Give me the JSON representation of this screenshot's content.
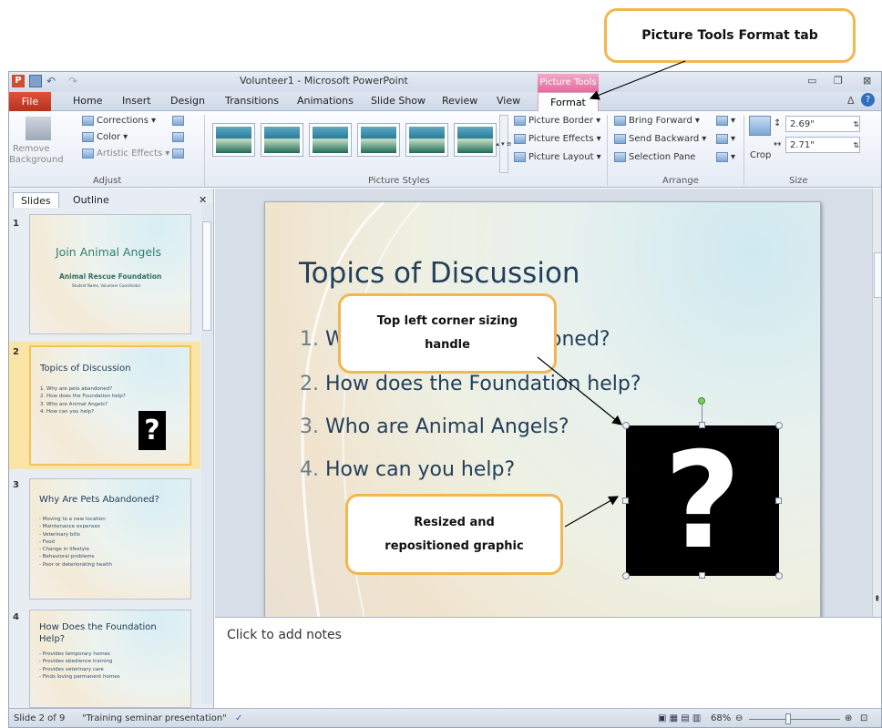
{
  "callouts": {
    "format_tab": "Picture Tools Format tab",
    "sizing_handle_line1": "Top left corner sizing",
    "sizing_handle_line2": "handle",
    "resized_line1": "Resized and",
    "resized_line2": "repositioned graphic"
  },
  "window": {
    "title": "Volunteer1 - Microsoft PowerPoint",
    "contextual_header": "Picture Tools"
  },
  "tabs": [
    "File",
    "Home",
    "Insert",
    "Design",
    "Transitions",
    "Animations",
    "Slide Show",
    "Review",
    "View",
    "Format"
  ],
  "ribbon": {
    "adjust": {
      "remove_bg_line1": "Remove",
      "remove_bg_line2": "Background",
      "corrections": "Corrections",
      "color": "Color",
      "artistic_effects": "Artistic Effects",
      "group_label": "Adjust"
    },
    "styles_group_label": "Picture Styles",
    "picture_border": "Picture Border",
    "picture_effects": "Picture Effects",
    "picture_layout": "Picture Layout",
    "arrange": {
      "bring_forward": "Bring Forward",
      "send_backward": "Send Backward",
      "selection_pane": "Selection Pane",
      "group_label": "Arrange"
    },
    "size": {
      "crop": "Crop",
      "height": "2.69\"",
      "width": "2.71\"",
      "group_label": "Size"
    }
  },
  "panel": {
    "tab_slides": "Slides",
    "tab_outline": "Outline"
  },
  "thumbnails": {
    "s1": {
      "num": "1",
      "title": "Join Animal Angels",
      "subtitle": "Animal Rescue Foundation",
      "byline": "Student Name, Volunteer Coordinator"
    },
    "s2": {
      "num": "2",
      "title": "Topics of Discussion",
      "lines": [
        "1.  Why are pets abandoned?",
        "2.  How does the Foundation   help?",
        "3.  Who are Animal Angels?",
        "4.  How can you help?"
      ]
    },
    "s3": {
      "num": "3",
      "title": "Why Are Pets Abandoned?",
      "lines": [
        "- Moving to a new location",
        "- Maintenance  expenses",
        "   - Veterinary bills",
        "   - Food",
        "- Change  in lifestyle",
        "- Behavioral  problems",
        "- Poor  or deteriorating  health"
      ]
    },
    "s4": {
      "num": "4",
      "title": "How Does the Foundation Help?",
      "lines": [
        "- Provides  temporary  homes",
        "- Provides  obedience  training",
        "- Provides  veterinary  care",
        "- Finds loving  permanent  homes"
      ]
    }
  },
  "slide": {
    "title": "Topics of Discussion",
    "items": [
      {
        "num": "1.",
        "text": "W"
      },
      {
        "num": "2.",
        "text": "How does the Foundation help?"
      },
      {
        "num": "3.",
        "text": "Who are Animal Angels?"
      },
      {
        "num": "4.",
        "text": "How can you help?"
      }
    ],
    "item1_tail": "oned?",
    "graphic_glyph": "?"
  },
  "notes_placeholder": "Click to add notes",
  "status": {
    "slide_pos": "Slide 2 of 9",
    "theme": "\"Training seminar presentation\"",
    "zoom": "68%"
  },
  "icons": [
    "powerpoint-icon",
    "save-icon",
    "undo-icon",
    "redo-icon",
    "minimize-icon",
    "restore-icon",
    "close-icon",
    "help-icon",
    "spell-check-icon"
  ],
  "colors": {
    "file_tab": "#c7412a",
    "picture_tools": "#e36b9d",
    "callout_border": "#f0b752",
    "slide_text": "#233f5c"
  }
}
